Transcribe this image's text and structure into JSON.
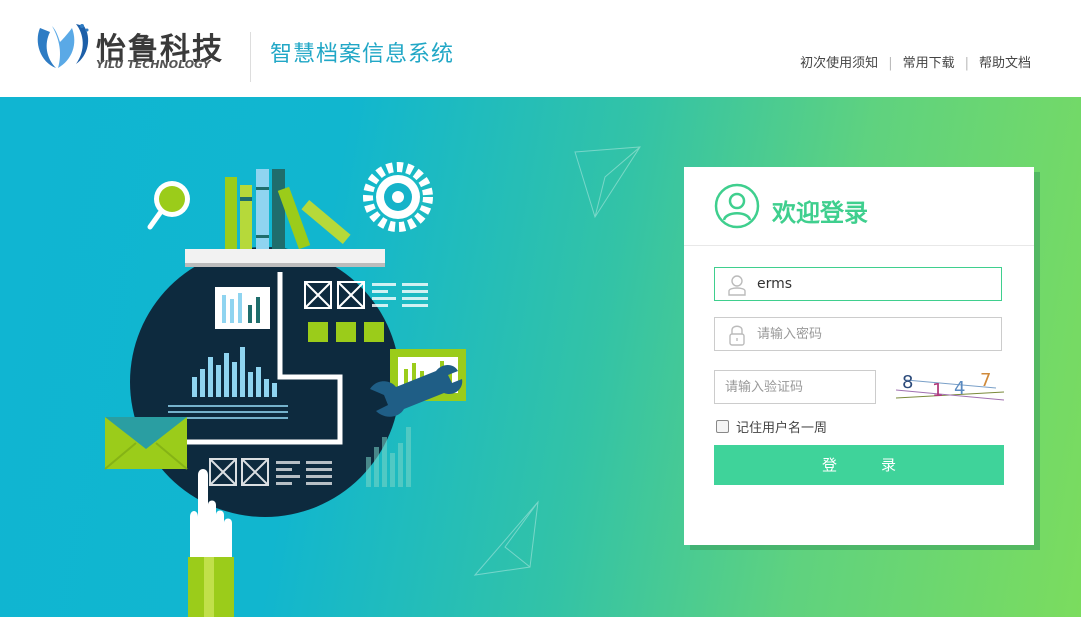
{
  "header": {
    "logo_cn": "怡鲁科技",
    "logo_en": "YILU TECHNOLOGY",
    "system_title": "智慧档案信息系统",
    "links": [
      "初次使用须知",
      "常用下载",
      "帮助文档"
    ]
  },
  "login": {
    "title": "欢迎登录",
    "username_value": "erms",
    "password_placeholder": "请输入密码",
    "captcha_placeholder": "请输入验证码",
    "captcha_text": "8147",
    "remember_label": "记住用户名一周",
    "login_label": "登录"
  },
  "colors": {
    "accent": "#3fd39a",
    "title_blue": "#21a7c6",
    "banner_start": "#10b5d2",
    "banner_end": "#7bdc5e"
  }
}
